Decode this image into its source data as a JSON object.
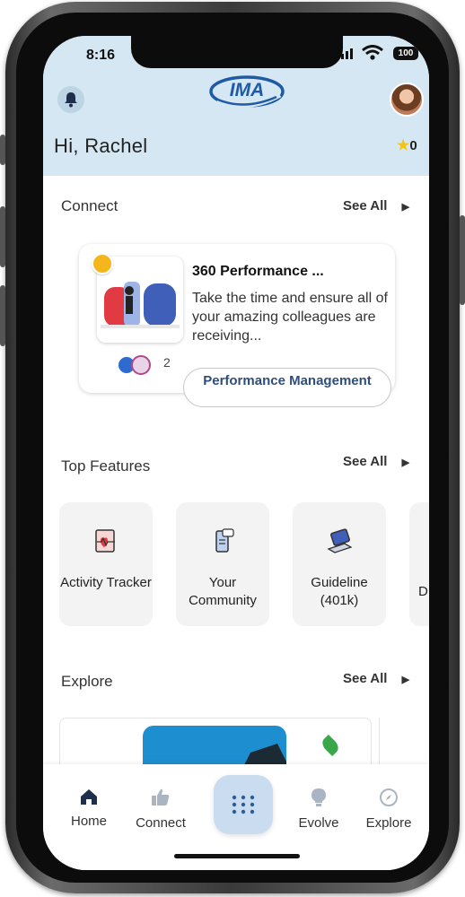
{
  "status_bar": {
    "time": "8:16",
    "battery": "100"
  },
  "header": {
    "logo": "IMA",
    "greeting": "Hi, Rachel",
    "points": "0"
  },
  "connect": {
    "title": "Connect",
    "see_all": "See All",
    "card": {
      "title": "360 Performance ...",
      "description": "Take the time and ensure all of your amazing colleagues are receiving...",
      "participant_count": "2",
      "tag": "Performance Management"
    }
  },
  "top_features": {
    "title": "Top Features",
    "see_all": "See All",
    "items": [
      {
        "label": "Activity Tracker",
        "icon": "heart-monitor-icon"
      },
      {
        "label": "Your Community",
        "icon": "phone-chat-icon"
      },
      {
        "label": "Guideline (401k)",
        "icon": "laptop-icon"
      },
      {
        "label": "D",
        "icon": ""
      }
    ]
  },
  "explore": {
    "title": "Explore",
    "see_all": "See All"
  },
  "bottom_nav": {
    "items": [
      {
        "label": "Home",
        "icon": "home-icon"
      },
      {
        "label": "Connect",
        "icon": "thumbs-up-icon"
      },
      {
        "label": "Evolve",
        "icon": "lightbulb-icon"
      },
      {
        "label": "Explore",
        "icon": "compass-icon"
      }
    ],
    "center_icon": "grid-icon"
  },
  "colors": {
    "header_bg": "#d5e7f2",
    "accent": "#1f5aa6",
    "tag_text": "#2f4d78"
  }
}
